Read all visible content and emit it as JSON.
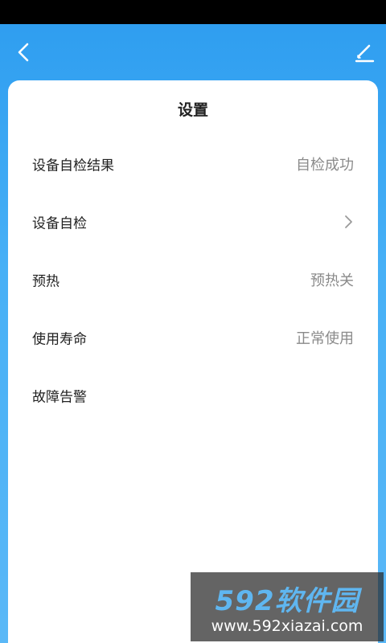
{
  "page": {
    "title": "设置"
  },
  "toolbar": {
    "back_icon": "chevron-left-icon",
    "edit_icon": "pencil-icon"
  },
  "rows": [
    {
      "label": "设备自检结果",
      "value": "自检成功"
    },
    {
      "label": "设备自检",
      "value": "",
      "icon": "chevron-right-icon"
    },
    {
      "label": "预热",
      "value": "预热关"
    },
    {
      "label": "使用寿命",
      "value": "正常使用"
    },
    {
      "label": "故障告警",
      "value": ""
    }
  ],
  "watermark": {
    "brand": "592软件园",
    "url": "www.592xiazai.com"
  },
  "colors": {
    "header": "#3aa6f3",
    "card": "#ffffff",
    "value_text": "#8a8a8a"
  }
}
